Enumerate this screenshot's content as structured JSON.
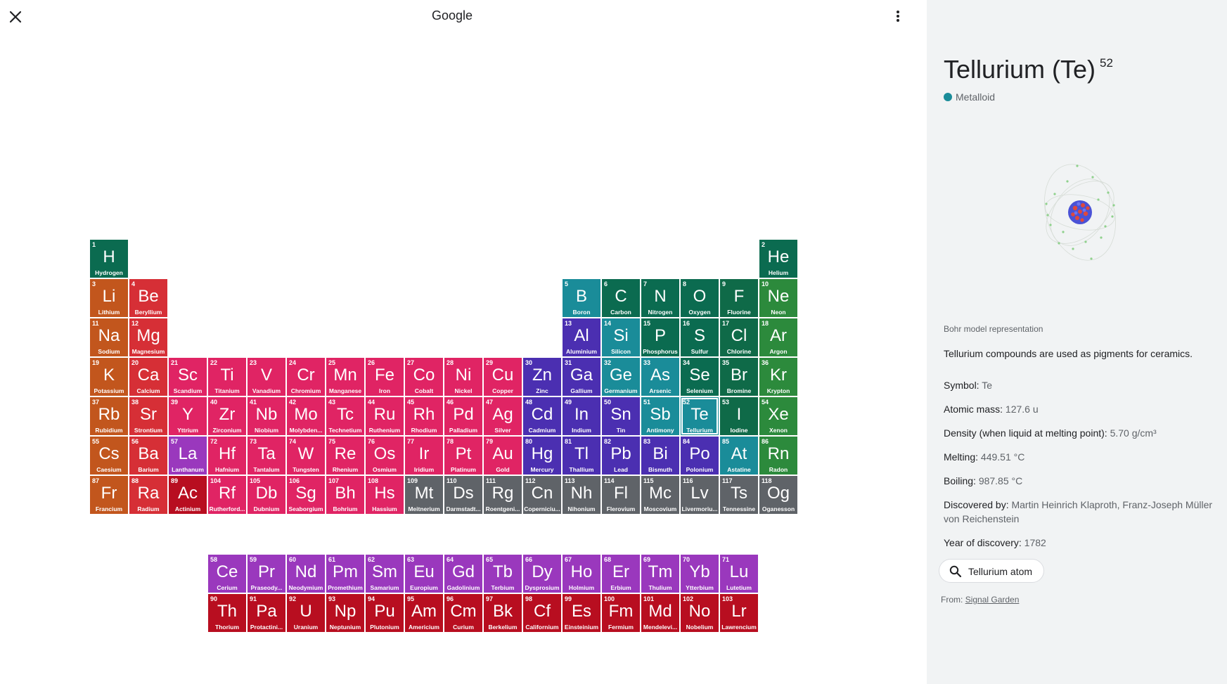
{
  "app": {
    "title": "Google"
  },
  "colors": {
    "alkali": "#c2561d",
    "alkaline": "#d62f36",
    "transition": "#e02464",
    "post_transition": "#4b2fb1",
    "metalloid": "#1a8c99",
    "nonmetal": "#0b6b50",
    "halogen": "#0f6a48",
    "noble": "#2c8a3c",
    "lanthanide": "#9a38bd",
    "actinide": "#b80e20",
    "unknown": "#5f6368"
  },
  "elements": [
    {
      "n": "1",
      "s": "H",
      "name": "Hydrogen",
      "c": "nonmetal",
      "row": 1,
      "col": 1
    },
    {
      "n": "2",
      "s": "He",
      "name": "Helium",
      "c": "nonmetal",
      "row": 1,
      "col": 18
    },
    {
      "n": "3",
      "s": "Li",
      "name": "Lithium",
      "c": "alkali",
      "row": 2,
      "col": 1
    },
    {
      "n": "4",
      "s": "Be",
      "name": "Beryllium",
      "c": "alkaline",
      "row": 2,
      "col": 2
    },
    {
      "n": "5",
      "s": "B",
      "name": "Boron",
      "c": "metalloid",
      "row": 2,
      "col": 13
    },
    {
      "n": "6",
      "s": "C",
      "name": "Carbon",
      "c": "nonmetal",
      "row": 2,
      "col": 14
    },
    {
      "n": "7",
      "s": "N",
      "name": "Nitrogen",
      "c": "nonmetal",
      "row": 2,
      "col": 15
    },
    {
      "n": "8",
      "s": "O",
      "name": "Oxygen",
      "c": "nonmetal",
      "row": 2,
      "col": 16
    },
    {
      "n": "9",
      "s": "F",
      "name": "Fluorine",
      "c": "halogen",
      "row": 2,
      "col": 17
    },
    {
      "n": "10",
      "s": "Ne",
      "name": "Neon",
      "c": "noble",
      "row": 2,
      "col": 18
    },
    {
      "n": "11",
      "s": "Na",
      "name": "Sodium",
      "c": "alkali",
      "row": 3,
      "col": 1
    },
    {
      "n": "12",
      "s": "Mg",
      "name": "Magnesium",
      "c": "alkaline",
      "row": 3,
      "col": 2
    },
    {
      "n": "13",
      "s": "Al",
      "name": "Aluminium",
      "c": "post_transition",
      "row": 3,
      "col": 13
    },
    {
      "n": "14",
      "s": "Si",
      "name": "Silicon",
      "c": "metalloid",
      "row": 3,
      "col": 14
    },
    {
      "n": "15",
      "s": "P",
      "name": "Phosphorus",
      "c": "nonmetal",
      "row": 3,
      "col": 15
    },
    {
      "n": "16",
      "s": "S",
      "name": "Sulfur",
      "c": "nonmetal",
      "row": 3,
      "col": 16
    },
    {
      "n": "17",
      "s": "Cl",
      "name": "Chlorine",
      "c": "halogen",
      "row": 3,
      "col": 17
    },
    {
      "n": "18",
      "s": "Ar",
      "name": "Argon",
      "c": "noble",
      "row": 3,
      "col": 18
    },
    {
      "n": "19",
      "s": "K",
      "name": "Potassium",
      "c": "alkali",
      "row": 4,
      "col": 1
    },
    {
      "n": "20",
      "s": "Ca",
      "name": "Calcium",
      "c": "alkaline",
      "row": 4,
      "col": 2
    },
    {
      "n": "21",
      "s": "Sc",
      "name": "Scandium",
      "c": "transition",
      "row": 4,
      "col": 3
    },
    {
      "n": "22",
      "s": "Ti",
      "name": "Titanium",
      "c": "transition",
      "row": 4,
      "col": 4
    },
    {
      "n": "23",
      "s": "V",
      "name": "Vanadium",
      "c": "transition",
      "row": 4,
      "col": 5
    },
    {
      "n": "24",
      "s": "Cr",
      "name": "Chromium",
      "c": "transition",
      "row": 4,
      "col": 6
    },
    {
      "n": "25",
      "s": "Mn",
      "name": "Manganese",
      "c": "transition",
      "row": 4,
      "col": 7
    },
    {
      "n": "26",
      "s": "Fe",
      "name": "Iron",
      "c": "transition",
      "row": 4,
      "col": 8
    },
    {
      "n": "27",
      "s": "Co",
      "name": "Cobalt",
      "c": "transition",
      "row": 4,
      "col": 9
    },
    {
      "n": "28",
      "s": "Ni",
      "name": "Nickel",
      "c": "transition",
      "row": 4,
      "col": 10
    },
    {
      "n": "29",
      "s": "Cu",
      "name": "Copper",
      "c": "transition",
      "row": 4,
      "col": 11
    },
    {
      "n": "30",
      "s": "Zn",
      "name": "Zinc",
      "c": "post_transition",
      "row": 4,
      "col": 12
    },
    {
      "n": "31",
      "s": "Ga",
      "name": "Gallium",
      "c": "post_transition",
      "row": 4,
      "col": 13
    },
    {
      "n": "32",
      "s": "Ge",
      "name": "Germanium",
      "c": "metalloid",
      "row": 4,
      "col": 14
    },
    {
      "n": "33",
      "s": "As",
      "name": "Arsenic",
      "c": "metalloid",
      "row": 4,
      "col": 15
    },
    {
      "n": "34",
      "s": "Se",
      "name": "Selenium",
      "c": "nonmetal",
      "row": 4,
      "col": 16
    },
    {
      "n": "35",
      "s": "Br",
      "name": "Bromine",
      "c": "halogen",
      "row": 4,
      "col": 17
    },
    {
      "n": "36",
      "s": "Kr",
      "name": "Krypton",
      "c": "noble",
      "row": 4,
      "col": 18
    },
    {
      "n": "37",
      "s": "Rb",
      "name": "Rubidium",
      "c": "alkali",
      "row": 5,
      "col": 1
    },
    {
      "n": "38",
      "s": "Sr",
      "name": "Strontium",
      "c": "alkaline",
      "row": 5,
      "col": 2
    },
    {
      "n": "39",
      "s": "Y",
      "name": "Yttrium",
      "c": "transition",
      "row": 5,
      "col": 3
    },
    {
      "n": "40",
      "s": "Zr",
      "name": "Zirconium",
      "c": "transition",
      "row": 5,
      "col": 4
    },
    {
      "n": "41",
      "s": "Nb",
      "name": "Niobium",
      "c": "transition",
      "row": 5,
      "col": 5
    },
    {
      "n": "42",
      "s": "Mo",
      "name": "Molybden...",
      "c": "transition",
      "row": 5,
      "col": 6
    },
    {
      "n": "43",
      "s": "Tc",
      "name": "Technetium",
      "c": "transition",
      "row": 5,
      "col": 7
    },
    {
      "n": "44",
      "s": "Ru",
      "name": "Ruthenium",
      "c": "transition",
      "row": 5,
      "col": 8
    },
    {
      "n": "45",
      "s": "Rh",
      "name": "Rhodium",
      "c": "transition",
      "row": 5,
      "col": 9
    },
    {
      "n": "46",
      "s": "Pd",
      "name": "Palladium",
      "c": "transition",
      "row": 5,
      "col": 10
    },
    {
      "n": "47",
      "s": "Ag",
      "name": "Silver",
      "c": "transition",
      "row": 5,
      "col": 11
    },
    {
      "n": "48",
      "s": "Cd",
      "name": "Cadmium",
      "c": "post_transition",
      "row": 5,
      "col": 12
    },
    {
      "n": "49",
      "s": "In",
      "name": "Indium",
      "c": "post_transition",
      "row": 5,
      "col": 13
    },
    {
      "n": "50",
      "s": "Sn",
      "name": "Tin",
      "c": "post_transition",
      "row": 5,
      "col": 14
    },
    {
      "n": "51",
      "s": "Sb",
      "name": "Antimony",
      "c": "metalloid",
      "row": 5,
      "col": 15
    },
    {
      "n": "52",
      "s": "Te",
      "name": "Tellurium",
      "c": "metalloid",
      "row": 5,
      "col": 16,
      "selected": true
    },
    {
      "n": "53",
      "s": "I",
      "name": "Iodine",
      "c": "halogen",
      "row": 5,
      "col": 17
    },
    {
      "n": "54",
      "s": "Xe",
      "name": "Xenon",
      "c": "noble",
      "row": 5,
      "col": 18
    },
    {
      "n": "55",
      "s": "Cs",
      "name": "Caesium",
      "c": "alkali",
      "row": 6,
      "col": 1
    },
    {
      "n": "56",
      "s": "Ba",
      "name": "Barium",
      "c": "alkaline",
      "row": 6,
      "col": 2
    },
    {
      "n": "57",
      "s": "La",
      "name": "Lanthanum",
      "c": "lanthanide",
      "row": 6,
      "col": 3
    },
    {
      "n": "72",
      "s": "Hf",
      "name": "Hafnium",
      "c": "transition",
      "row": 6,
      "col": 4
    },
    {
      "n": "73",
      "s": "Ta",
      "name": "Tantalum",
      "c": "transition",
      "row": 6,
      "col": 5
    },
    {
      "n": "74",
      "s": "W",
      "name": "Tungsten",
      "c": "transition",
      "row": 6,
      "col": 6
    },
    {
      "n": "75",
      "s": "Re",
      "name": "Rhenium",
      "c": "transition",
      "row": 6,
      "col": 7
    },
    {
      "n": "76",
      "s": "Os",
      "name": "Osmium",
      "c": "transition",
      "row": 6,
      "col": 8
    },
    {
      "n": "77",
      "s": "Ir",
      "name": "Iridium",
      "c": "transition",
      "row": 6,
      "col": 9
    },
    {
      "n": "78",
      "s": "Pt",
      "name": "Platinum",
      "c": "transition",
      "row": 6,
      "col": 10
    },
    {
      "n": "79",
      "s": "Au",
      "name": "Gold",
      "c": "transition",
      "row": 6,
      "col": 11
    },
    {
      "n": "80",
      "s": "Hg",
      "name": "Mercury",
      "c": "post_transition",
      "row": 6,
      "col": 12
    },
    {
      "n": "81",
      "s": "Tl",
      "name": "Thallium",
      "c": "post_transition",
      "row": 6,
      "col": 13
    },
    {
      "n": "82",
      "s": "Pb",
      "name": "Lead",
      "c": "post_transition",
      "row": 6,
      "col": 14
    },
    {
      "n": "83",
      "s": "Bi",
      "name": "Bismuth",
      "c": "post_transition",
      "row": 6,
      "col": 15
    },
    {
      "n": "84",
      "s": "Po",
      "name": "Polonium",
      "c": "post_transition",
      "row": 6,
      "col": 16
    },
    {
      "n": "85",
      "s": "At",
      "name": "Astatine",
      "c": "metalloid",
      "row": 6,
      "col": 17
    },
    {
      "n": "86",
      "s": "Rn",
      "name": "Radon",
      "c": "noble",
      "row": 6,
      "col": 18
    },
    {
      "n": "87",
      "s": "Fr",
      "name": "Francium",
      "c": "alkali",
      "row": 7,
      "col": 1
    },
    {
      "n": "88",
      "s": "Ra",
      "name": "Radium",
      "c": "alkaline",
      "row": 7,
      "col": 2
    },
    {
      "n": "89",
      "s": "Ac",
      "name": "Actinium",
      "c": "actinide",
      "row": 7,
      "col": 3
    },
    {
      "n": "104",
      "s": "Rf",
      "name": "Rutherford...",
      "c": "transition",
      "row": 7,
      "col": 4
    },
    {
      "n": "105",
      "s": "Db",
      "name": "Dubnium",
      "c": "transition",
      "row": 7,
      "col": 5
    },
    {
      "n": "106",
      "s": "Sg",
      "name": "Seaborgium",
      "c": "transition",
      "row": 7,
      "col": 6
    },
    {
      "n": "107",
      "s": "Bh",
      "name": "Bohrium",
      "c": "transition",
      "row": 7,
      "col": 7
    },
    {
      "n": "108",
      "s": "Hs",
      "name": "Hassium",
      "c": "transition",
      "row": 7,
      "col": 8
    },
    {
      "n": "109",
      "s": "Mt",
      "name": "Meitnerium",
      "c": "unknown",
      "row": 7,
      "col": 9
    },
    {
      "n": "110",
      "s": "Ds",
      "name": "Darmstadt...",
      "c": "unknown",
      "row": 7,
      "col": 10
    },
    {
      "n": "111",
      "s": "Rg",
      "name": "Roentgeni...",
      "c": "unknown",
      "row": 7,
      "col": 11
    },
    {
      "n": "112",
      "s": "Cn",
      "name": "Coperniciu...",
      "c": "unknown",
      "row": 7,
      "col": 12
    },
    {
      "n": "113",
      "s": "Nh",
      "name": "Nihonium",
      "c": "unknown",
      "row": 7,
      "col": 13
    },
    {
      "n": "114",
      "s": "Fl",
      "name": "Flerovium",
      "c": "unknown",
      "row": 7,
      "col": 14
    },
    {
      "n": "115",
      "s": "Mc",
      "name": "Moscovium",
      "c": "unknown",
      "row": 7,
      "col": 15
    },
    {
      "n": "116",
      "s": "Lv",
      "name": "Livermoriu...",
      "c": "unknown",
      "row": 7,
      "col": 16
    },
    {
      "n": "117",
      "s": "Ts",
      "name": "Tennessine",
      "c": "unknown",
      "row": 7,
      "col": 17
    },
    {
      "n": "118",
      "s": "Og",
      "name": "Oganesson",
      "c": "unknown",
      "row": 7,
      "col": 18
    },
    {
      "n": "58",
      "s": "Ce",
      "name": "Cerium",
      "c": "lanthanide",
      "row": 9,
      "col": 4
    },
    {
      "n": "59",
      "s": "Pr",
      "name": "Praseody...",
      "c": "lanthanide",
      "row": 9,
      "col": 5
    },
    {
      "n": "60",
      "s": "Nd",
      "name": "Neodymium",
      "c": "lanthanide",
      "row": 9,
      "col": 6
    },
    {
      "n": "61",
      "s": "Pm",
      "name": "Promethium",
      "c": "lanthanide",
      "row": 9,
      "col": 7
    },
    {
      "n": "62",
      "s": "Sm",
      "name": "Samarium",
      "c": "lanthanide",
      "row": 9,
      "col": 8
    },
    {
      "n": "63",
      "s": "Eu",
      "name": "Europium",
      "c": "lanthanide",
      "row": 9,
      "col": 9
    },
    {
      "n": "64",
      "s": "Gd",
      "name": "Gadolinium",
      "c": "lanthanide",
      "row": 9,
      "col": 10
    },
    {
      "n": "65",
      "s": "Tb",
      "name": "Terbium",
      "c": "lanthanide",
      "row": 9,
      "col": 11
    },
    {
      "n": "66",
      "s": "Dy",
      "name": "Dysprosium",
      "c": "lanthanide",
      "row": 9,
      "col": 12
    },
    {
      "n": "67",
      "s": "Ho",
      "name": "Holmium",
      "c": "lanthanide",
      "row": 9,
      "col": 13
    },
    {
      "n": "68",
      "s": "Er",
      "name": "Erbium",
      "c": "lanthanide",
      "row": 9,
      "col": 14
    },
    {
      "n": "69",
      "s": "Tm",
      "name": "Thulium",
      "c": "lanthanide",
      "row": 9,
      "col": 15
    },
    {
      "n": "70",
      "s": "Yb",
      "name": "Ytterbium",
      "c": "lanthanide",
      "row": 9,
      "col": 16
    },
    {
      "n": "71",
      "s": "Lu",
      "name": "Lutetium",
      "c": "lanthanide",
      "row": 9,
      "col": 17
    },
    {
      "n": "90",
      "s": "Th",
      "name": "Thorium",
      "c": "actinide",
      "row": 10,
      "col": 4
    },
    {
      "n": "91",
      "s": "Pa",
      "name": "Protactini...",
      "c": "actinide",
      "row": 10,
      "col": 5
    },
    {
      "n": "92",
      "s": "U",
      "name": "Uranium",
      "c": "actinide",
      "row": 10,
      "col": 6
    },
    {
      "n": "93",
      "s": "Np",
      "name": "Neptunium",
      "c": "actinide",
      "row": 10,
      "col": 7
    },
    {
      "n": "94",
      "s": "Pu",
      "name": "Plutonium",
      "c": "actinide",
      "row": 10,
      "col": 8
    },
    {
      "n": "95",
      "s": "Am",
      "name": "Americium",
      "c": "actinide",
      "row": 10,
      "col": 9
    },
    {
      "n": "96",
      "s": "Cm",
      "name": "Curium",
      "c": "actinide",
      "row": 10,
      "col": 10
    },
    {
      "n": "97",
      "s": "Bk",
      "name": "Berkelium",
      "c": "actinide",
      "row": 10,
      "col": 11
    },
    {
      "n": "98",
      "s": "Cf",
      "name": "Californium",
      "c": "actinide",
      "row": 10,
      "col": 12
    },
    {
      "n": "99",
      "s": "Es",
      "name": "Einsteinium",
      "c": "actinide",
      "row": 10,
      "col": 13
    },
    {
      "n": "100",
      "s": "Fm",
      "name": "Fermium",
      "c": "actinide",
      "row": 10,
      "col": 14
    },
    {
      "n": "101",
      "s": "Md",
      "name": "Mendelevi...",
      "c": "actinide",
      "row": 10,
      "col": 15
    },
    {
      "n": "102",
      "s": "No",
      "name": "Nobelium",
      "c": "actinide",
      "row": 10,
      "col": 16
    },
    {
      "n": "103",
      "s": "Lr",
      "name": "Lawrencium",
      "c": "actinide",
      "row": 10,
      "col": 17
    }
  ],
  "panel": {
    "title": "Tellurium (Te)",
    "atomic_number": "52",
    "category": "Metalloid",
    "bohr_caption": "Bohr model representation",
    "fact": "Tellurium compounds are used as pigments for ceramics.",
    "properties": [
      {
        "label": "Symbol:",
        "value": "Te"
      },
      {
        "label": "Atomic mass:",
        "value": "127.6 u"
      },
      {
        "label": "Density (when liquid at melting point):",
        "value": "5.70 g/cm³"
      },
      {
        "label": "Melting:",
        "value": "449.51 °C"
      },
      {
        "label": "Boiling:",
        "value": "987.85 °C"
      },
      {
        "label": "Discovered by:",
        "value": "Martin Heinrich Klaproth, Franz-Joseph Müller von Reichenstein"
      },
      {
        "label": "Year of discovery:",
        "value": "1782"
      }
    ],
    "search_chip": "Tellurium atom",
    "source_prefix": "From:",
    "source_link": "Signal Garden"
  }
}
